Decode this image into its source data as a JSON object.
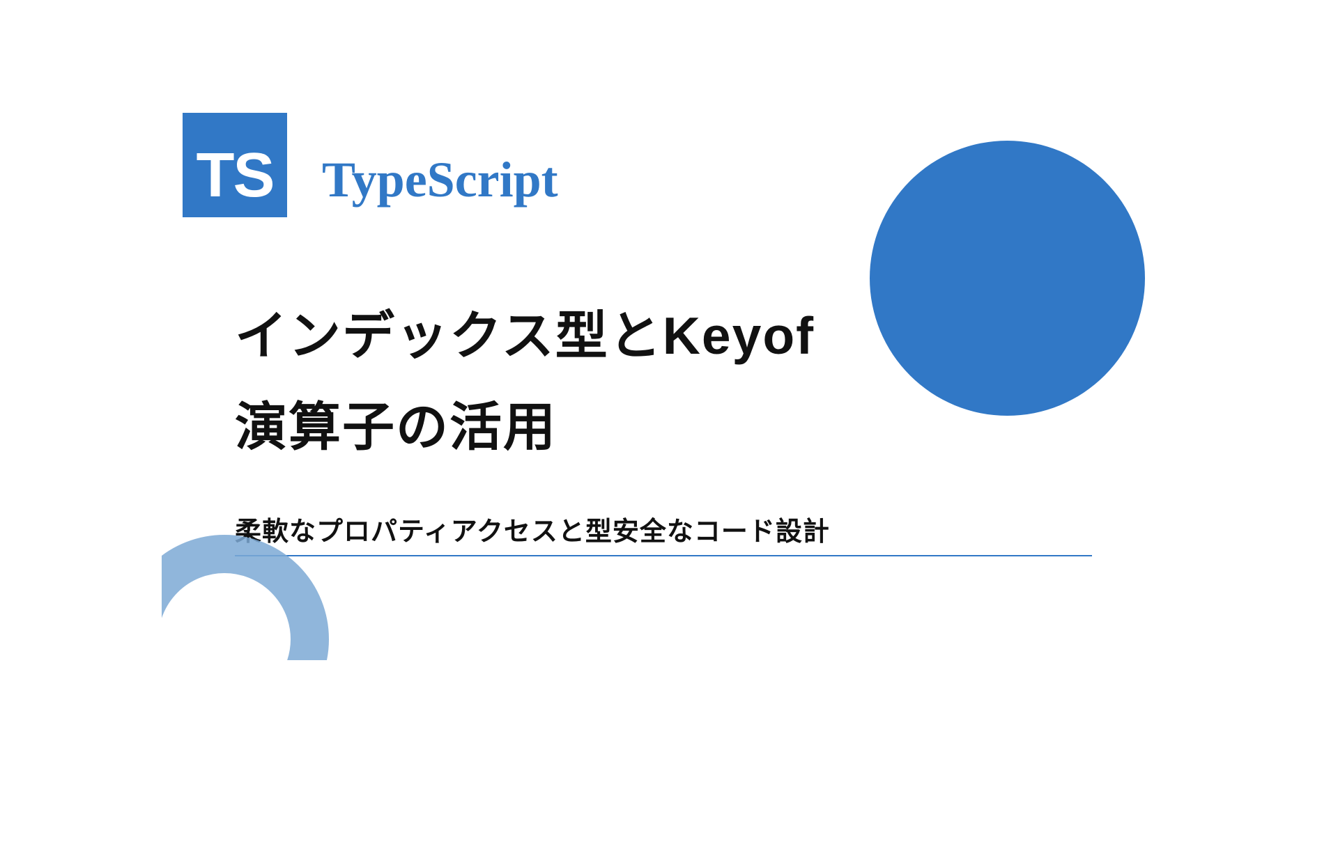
{
  "logo": {
    "text": "TS"
  },
  "brand": "TypeScript",
  "title_line1": "インデックス型とKeyof",
  "title_line2": "演算子の活用",
  "subtitle": "柔軟なプロパティアクセスと型安全なコード設計",
  "colors": {
    "accent": "#3178c6",
    "ring": "#7da9d5",
    "text": "#111111"
  }
}
